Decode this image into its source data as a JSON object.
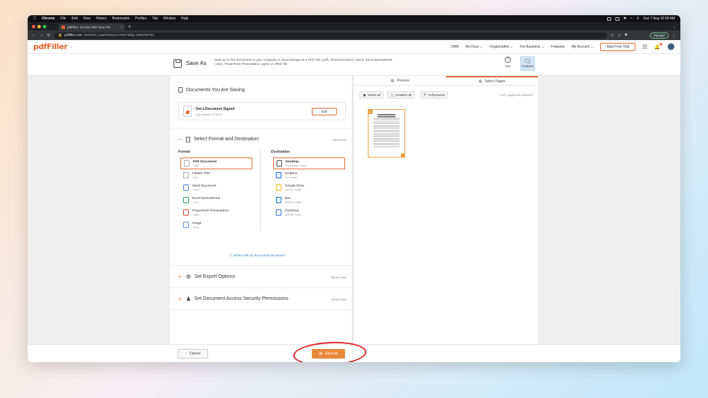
{
  "menubar": {
    "app": "Chrome",
    "items": [
      "File",
      "Edit",
      "View",
      "History",
      "Bookmarks",
      "Profiles",
      "Tab",
      "Window",
      "Help"
    ],
    "clock": "Sun 7 Aug  10:30 AM"
  },
  "browser": {
    "tab_title": "pdfFiller: On-line PDF form Fill",
    "url_host": "pdffiller.com",
    "url_path": "/en/multi_export/saveAs.htm?ids[]=1061232751",
    "profile_status": "Paused"
  },
  "header": {
    "logo": "pdfFiller",
    "nav": [
      "CRM",
      "My Docs",
      "Organization",
      "For Business",
      "Features",
      "My Account"
    ],
    "trial_button": "Start Free Trial",
    "notif_count": "3"
  },
  "toolbar": {
    "title": "Save As",
    "description": "Save up to five documents to your computer or cloud storage as a PDF File (.pdf), Word Document (.docx), Excel Spreadsheet (.xlsx), PowerPoint Presentation (.pptx) or JPEG file.",
    "help_label": "Help",
    "feedback_label": "Feedback"
  },
  "documents": {
    "title": "Documents You Are Saving",
    "doc_name": "Get a Document Signed",
    "doc_date": "Last update: 07/30/22",
    "edit_label": "Edit"
  },
  "format_section": {
    "title": "Select Format and Destination",
    "toggle_label": "Show less",
    "format_header": "Format",
    "destination_header": "Destination",
    "formats": [
      {
        "label": "PDF Document",
        "ext": "*.pdf"
      },
      {
        "label": "Fillable PDF",
        "ext": "*.pdf"
      },
      {
        "label": "Word Document",
        "ext": "*.docx"
      },
      {
        "label": "Excel Spreadsheet",
        "ext": "*.xlsx"
      },
      {
        "label": "PowerPoint Presentation",
        "ext": "*.pptx"
      },
      {
        "label": "Image",
        "ext": "*.jpeg"
      }
    ],
    "destinations": [
      {
        "label": "Desktop",
        "sub": "Downloads folder"
      },
      {
        "label": "Dropbox",
        "sub": "Your folder"
      },
      {
        "label": "Google Drive",
        "sub": "pdfFiller folder"
      },
      {
        "label": "Box",
        "sub": "pdfFiller folder"
      },
      {
        "label": "OneDrive",
        "sub": "pdfFiller folder"
      }
    ],
    "where_link": "Where will my documents be saved?"
  },
  "export_section": {
    "title": "Set Export Options",
    "toggle_label": "Show more"
  },
  "security_section": {
    "title": "Set Document Access Security Permissions",
    "toggle_label": "Show more"
  },
  "preview": {
    "tab_preview": "Preview",
    "tab_select_pages": "Select Pages",
    "select_all": "Select all",
    "unselect_all": "Unselect all",
    "full_preview": "Full preview",
    "selection_count": "1 of 1 pages are selected",
    "page_number": "1"
  },
  "footer": {
    "cancel_label": "Cancel",
    "saveas_label": "Save As"
  },
  "colors": {
    "accent": "#e8612c",
    "highlight": "#e02020",
    "link": "#3a7bd5"
  }
}
